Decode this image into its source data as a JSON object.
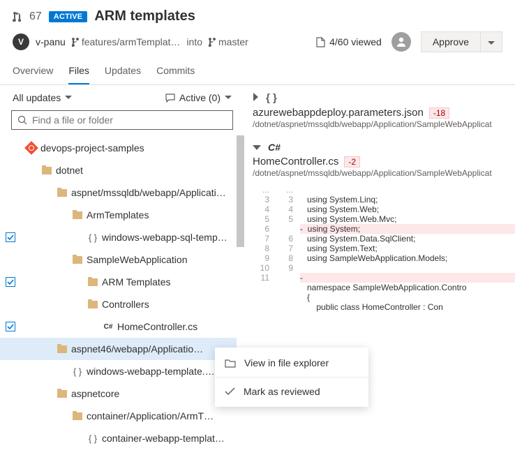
{
  "header": {
    "pr_number": "67",
    "status_badge": "ACTIVE",
    "title": "ARM templates",
    "avatar_initial": "V",
    "username": "v-panu",
    "source_branch": "features/armTemplat…",
    "into_word": "into",
    "target_branch": "master",
    "viewed_text": "4/60 viewed",
    "approve_label": "Approve"
  },
  "tabs": [
    "Overview",
    "Files",
    "Updates",
    "Commits"
  ],
  "filters": {
    "updates_label": "All updates",
    "comments_label": "Active (0)"
  },
  "search": {
    "placeholder": "Find a file or folder"
  },
  "tree": [
    {
      "icon": "git",
      "label": "devops-project-samples",
      "indent": 36,
      "chk": ""
    },
    {
      "icon": "folder",
      "label": "dotnet",
      "indent": 58,
      "chk": ""
    },
    {
      "icon": "folder",
      "label": "aspnet/mssqldb/webapp/Applicati…",
      "indent": 80,
      "chk": ""
    },
    {
      "icon": "folder",
      "label": "ArmTemplates",
      "indent": 102,
      "chk": ""
    },
    {
      "icon": "file",
      "label": "windows-webapp-sql-temp…",
      "indent": 124,
      "chk": "check"
    },
    {
      "icon": "folder",
      "label": "SampleWebApplication",
      "indent": 102,
      "chk": ""
    },
    {
      "icon": "folder",
      "label": "ARM Templates",
      "indent": 124,
      "chk": "check"
    },
    {
      "icon": "folder",
      "label": "Controllers",
      "indent": 124,
      "chk": ""
    },
    {
      "icon": "cs",
      "label": "HomeController.cs",
      "indent": 146,
      "chk": "check"
    },
    {
      "icon": "folder",
      "label": "aspnet46/webapp/Applicatio…",
      "indent": 80,
      "chk": "",
      "more": true,
      "active": true
    },
    {
      "icon": "file",
      "label": "windows-webapp-template.…",
      "indent": 102,
      "chk": ""
    },
    {
      "icon": "folder",
      "label": "aspnetcore",
      "indent": 80,
      "chk": ""
    },
    {
      "icon": "folder",
      "label": "container/Application/ArmT…",
      "indent": 102,
      "chk": ""
    },
    {
      "icon": "file",
      "label": "container-webapp-templat…",
      "indent": 124,
      "chk": ""
    }
  ],
  "context_menu": {
    "view": "View in file explorer",
    "mark": "Mark as reviewed"
  },
  "files": [
    {
      "collapsed": true,
      "lang": "{ }",
      "name": "azurewebappdeploy.parameters.json",
      "diff": "-18",
      "path": "/dotnet/aspnet/mssqldb/webapp/Application/SampleWebApplicat"
    },
    {
      "collapsed": false,
      "lang_cs": "C#",
      "name": "HomeController.cs",
      "diff": "-2",
      "path": "/dotnet/aspnet/mssqldb/webapp/Application/SampleWebApplicat"
    }
  ],
  "diff_lines": [
    {
      "a": "...",
      "b": "...",
      "t": "",
      "dots": true
    },
    {
      "a": "3",
      "b": "3",
      "t": "   using System.Linq;"
    },
    {
      "a": "4",
      "b": "4",
      "t": "   using System.Web;"
    },
    {
      "a": "5",
      "b": "5",
      "t": "   using System.Web.Mvc;"
    },
    {
      "a": "6",
      "b": "",
      "t": "-  using System;",
      "removed": true
    },
    {
      "a": "7",
      "b": "6",
      "t": "   using System.Data.SqlClient;"
    },
    {
      "a": "8",
      "b": "7",
      "t": "   using System.Text;"
    },
    {
      "a": "9",
      "b": "8",
      "t": "   using SampleWebApplication.Models;"
    },
    {
      "a": "10",
      "b": "9",
      "t": ""
    },
    {
      "a": "11",
      "b": "",
      "t": "-",
      "removed": true
    },
    {
      "a": "",
      "b": "",
      "t": "   namespace SampleWebApplication.Contro"
    },
    {
      "a": "",
      "b": "",
      "t": "   {"
    },
    {
      "a": "",
      "b": "",
      "t": "       public class HomeController : Con"
    }
  ]
}
